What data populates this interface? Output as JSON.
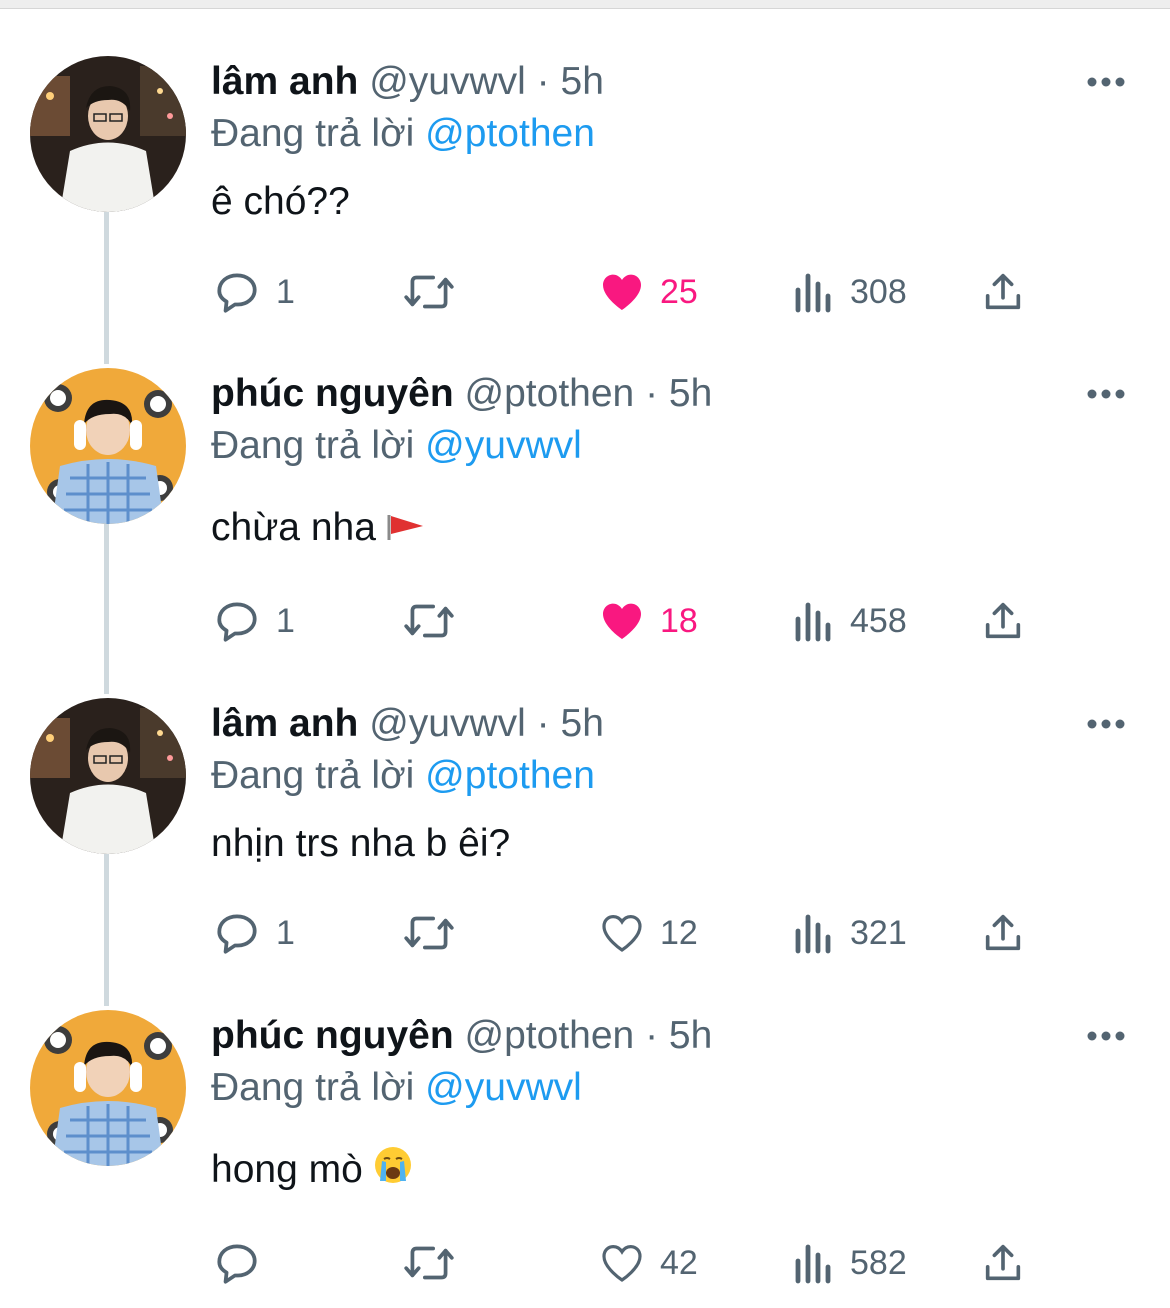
{
  "reply_prefix": "Đang trả lời",
  "colors": {
    "accent": "#1d9bf0",
    "like": "#f91880",
    "muted": "#536471",
    "thread_line": "#cfd9de"
  },
  "tweets": [
    {
      "name": "lâm anh",
      "handle": "@yuvwvl",
      "sep": "·",
      "time": "5h",
      "reply_to": "@ptothen",
      "text": "ê chó??",
      "emoji_icon": null,
      "avatar_icon": "user-avatar",
      "replies": "1",
      "likes": "25",
      "liked": true,
      "views": "308"
    },
    {
      "name": "phúc nguyên",
      "handle": "@ptothen",
      "sep": "·",
      "time": "5h",
      "reply_to": "@yuvwvl",
      "text": "chừa nha",
      "emoji_icon": "red-flag-emoji",
      "avatar_icon": "user-avatar",
      "replies": "1",
      "likes": "18",
      "liked": true,
      "views": "458"
    },
    {
      "name": "lâm anh",
      "handle": "@yuvwvl",
      "sep": "·",
      "time": "5h",
      "reply_to": "@ptothen",
      "text": "nhịn trs nha b êi?",
      "emoji_icon": null,
      "avatar_icon": "user-avatar",
      "replies": "1",
      "likes": "12",
      "liked": false,
      "views": "321"
    },
    {
      "name": "phúc nguyên",
      "handle": "@ptothen",
      "sep": "·",
      "time": "5h",
      "reply_to": "@yuvwvl",
      "text": "hong mò",
      "emoji_icon": "crying-face-emoji",
      "avatar_icon": "user-avatar",
      "replies": "",
      "likes": "42",
      "liked": false,
      "views": "582"
    }
  ]
}
